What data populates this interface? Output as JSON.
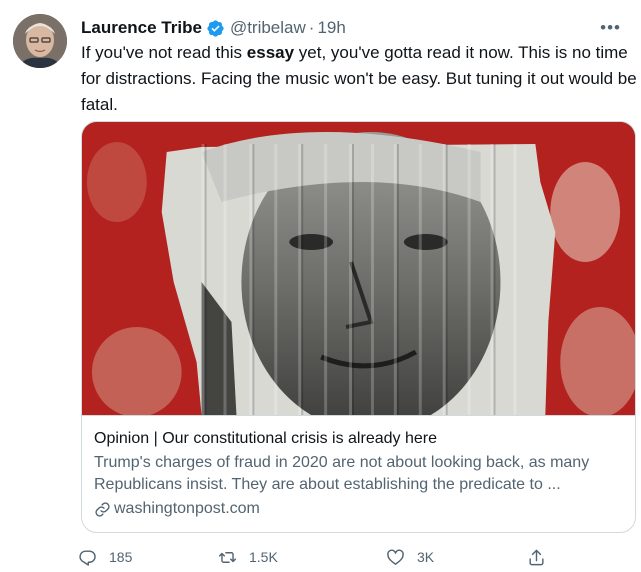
{
  "author": {
    "display_name": "Laurence Tribe",
    "handle": "@tribelaw",
    "time": "19h",
    "separator": "·"
  },
  "tweet": {
    "text_before": "If you've not read this ",
    "bold_word": "essay",
    "text_after": " yet, you've gotta read it now. This is no time for distractions. Facing the music won't be easy. But tuning it out would be fatal."
  },
  "card": {
    "title": "Opinion | Our constitutional crisis is already here",
    "description": "Trump's charges of fraud in 2020 are not about looking back, as many Republicans insist. They are about establishing the predicate to ...",
    "domain": "washingtonpost.com"
  },
  "actions": {
    "reply_count": "185",
    "retweet_count": "1.5K",
    "like_count": "3K"
  },
  "colors": {
    "text_primary": "#0f1419",
    "text_secondary": "#536471",
    "verified_blue": "#1d9bf0",
    "card_border": "#cfd9de",
    "image_red": "#b3221f"
  },
  "icons": [
    "verified-icon",
    "more-icon",
    "link-icon",
    "reply-icon",
    "retweet-icon",
    "like-icon",
    "share-icon"
  ]
}
